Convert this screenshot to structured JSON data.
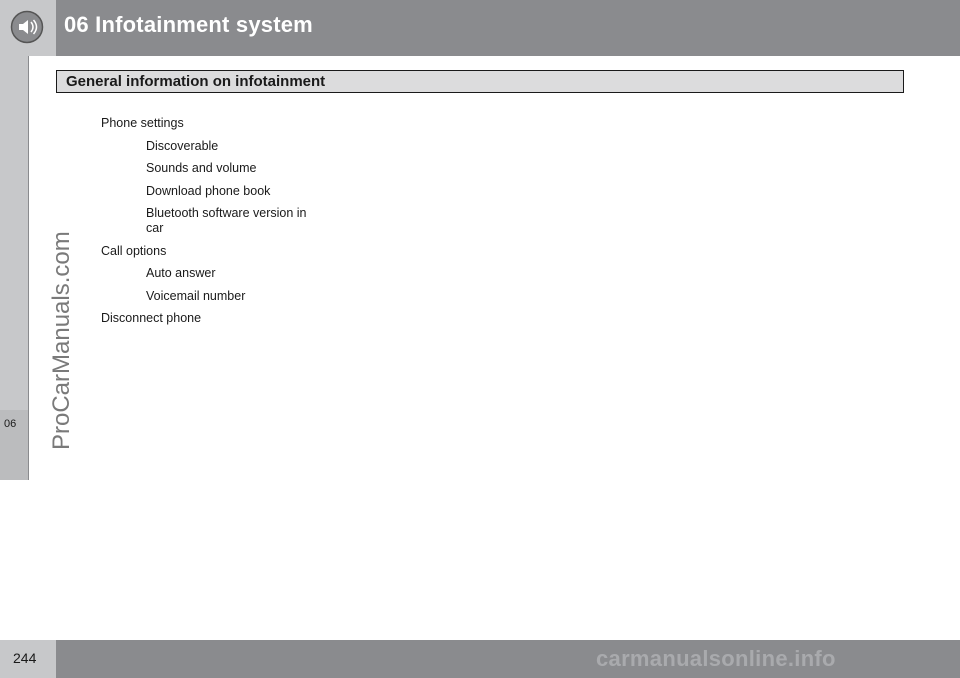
{
  "header": {
    "title": "06  Infotainment system",
    "icon": "speaker-icon"
  },
  "side_tab": {
    "label": "06"
  },
  "watermark": "ProCarManuals.com",
  "section": {
    "title": "General information on infotainment"
  },
  "menu": [
    {
      "label": "Phone settings",
      "level": 0
    },
    {
      "label": "Discoverable",
      "level": 1
    },
    {
      "label": "Sounds and volume",
      "level": 1
    },
    {
      "label": "Download phone book",
      "level": 1
    },
    {
      "label": "Bluetooth software version in car",
      "level": 1
    },
    {
      "label": "Call options",
      "level": 0
    },
    {
      "label": "Auto answer",
      "level": 1
    },
    {
      "label": "Voicemail number",
      "level": 1
    },
    {
      "label": "Disconnect phone",
      "level": 0
    }
  ],
  "footer": {
    "page_number": "244",
    "watermark": "carmanualsonline.info"
  }
}
